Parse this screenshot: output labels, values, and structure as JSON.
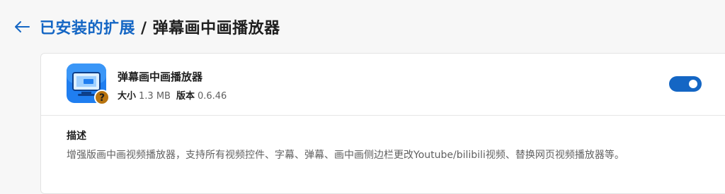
{
  "header": {
    "back_icon": "arrow-left-icon",
    "breadcrumb_link": "已安装的扩展",
    "separator": "/",
    "current": "弹幕画中画播放器"
  },
  "extension": {
    "name": "弹幕画中画播放器",
    "icon": "tv-monitor-icon",
    "badge_icon": "question-mark-icon",
    "size_label": "大小",
    "size_value": "1.3 MB",
    "version_label": "版本",
    "version_value": "0.6.46",
    "enabled": true
  },
  "description": {
    "title": "描述",
    "text": "增强版画中画视频播放器，支持所有视频控件、字幕、弹幕、画中画侧边栏更改Youtube/bilibili视频、替换网页视频播放器等。"
  },
  "colors": {
    "accent": "#1466c4",
    "background": "#f7f7f7",
    "card": "#ffffff",
    "badge": "#b8740f"
  }
}
